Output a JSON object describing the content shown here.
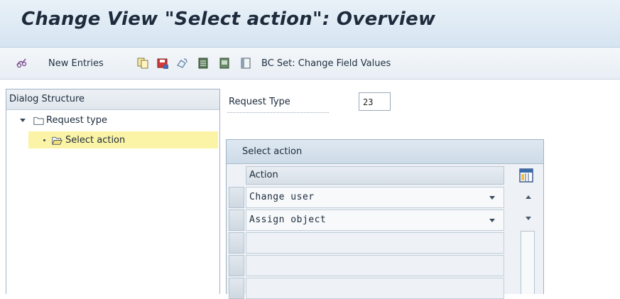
{
  "window": {
    "title": "Change View \"Select action\": Overview"
  },
  "toolbar": {
    "new_entries_label": "New Entries",
    "bc_set_label": "BC Set: Change Field Values",
    "icons": [
      "glasses-icon",
      "copy-icon",
      "save-icon",
      "undo-icon",
      "select-all-icon",
      "select-block-icon",
      "deselect-icon"
    ]
  },
  "dialog_structure": {
    "header": "Dialog Structure",
    "items": [
      {
        "label": "Request type",
        "expanded": true
      },
      {
        "label": "Select action",
        "selected": true
      }
    ]
  },
  "request": {
    "label": "Request Type",
    "value": "23"
  },
  "table": {
    "title": "Select action",
    "column_header": "Action",
    "rows": [
      "Change user",
      "Assign object",
      "",
      "",
      ""
    ]
  },
  "colors": {
    "title_bg": "#d6e4f1",
    "selected_tree_bg": "#fbf3a5",
    "frame_border": "#9fb3c6"
  }
}
